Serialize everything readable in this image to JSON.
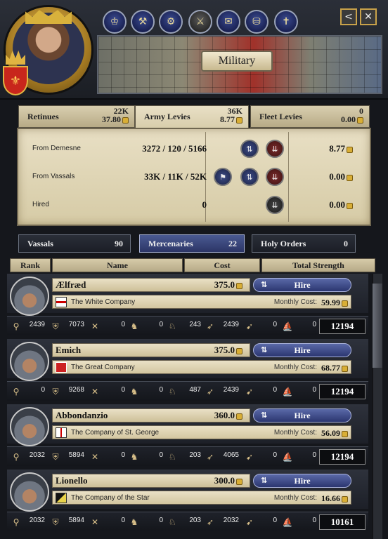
{
  "header": {
    "title": "Military"
  },
  "top_icons": [
    "crown-icon",
    "hammer-icon",
    "gears-icon",
    "sword-icon",
    "scroll-icon",
    "chest-icon",
    "cross-icon"
  ],
  "window_buttons": {
    "back": "<",
    "close": "✕"
  },
  "levy_tabs": [
    {
      "label": "Retinues",
      "top": "22K",
      "bottom": "37.80"
    },
    {
      "label": "Army Levies",
      "top": "36K",
      "bottom": "8.77"
    },
    {
      "label": "Fleet Levies",
      "top": "0",
      "bottom": "0.00"
    }
  ],
  "levies": [
    {
      "label": "From Demesne",
      "nums": "3272  /  120  /  5166",
      "amount": "8.77"
    },
    {
      "label": "From Vassals",
      "nums": "33K  /  11K  /  52K",
      "amount": "0.00"
    },
    {
      "label": "Hired",
      "nums": "0",
      "amount": "0.00"
    }
  ],
  "bottom_tabs": [
    {
      "label": "Vassals",
      "count": "90"
    },
    {
      "label": "Mercenaries",
      "count": "22"
    },
    {
      "label": "Holy Orders",
      "count": "0"
    }
  ],
  "columns": [
    "Rank",
    "Name",
    "Cost",
    "Total Strength"
  ],
  "hire_label": "Hire",
  "monthly_label": "Monthly Cost:",
  "mercs": [
    {
      "name": "Ælfræd",
      "cost": "375.0",
      "company": "The White Company",
      "monthly": "59.99",
      "stats": [
        "2439",
        "7073",
        "0",
        "0",
        "243",
        "2439",
        "0",
        "0"
      ],
      "total": "12194"
    },
    {
      "name": "Emich",
      "cost": "375.0",
      "company": "The Great Company",
      "monthly": "68.77",
      "stats": [
        "0",
        "9268",
        "0",
        "0",
        "487",
        "2439",
        "0",
        "0"
      ],
      "total": "12194"
    },
    {
      "name": "Abbondanzio",
      "cost": "360.0",
      "company": "The Company of St. George",
      "monthly": "56.09",
      "stats": [
        "2032",
        "5894",
        "0",
        "0",
        "203",
        "4065",
        "0",
        "0"
      ],
      "total": "12194"
    },
    {
      "name": "Lionello",
      "cost": "300.0",
      "company": "The Company of the Star",
      "monthly": "16.66",
      "stats": [
        "2032",
        "5894",
        "0",
        "0",
        "203",
        "2032",
        "0",
        "0"
      ],
      "total": "10161"
    }
  ],
  "colors": {
    "accent": "#3c4a8a",
    "parchment": "#e0d6b8",
    "dark": "#1b1e26"
  }
}
